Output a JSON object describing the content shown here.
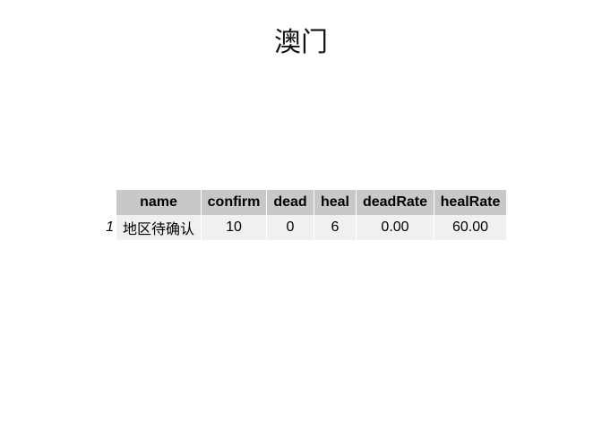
{
  "title": "澳门",
  "table": {
    "columns": [
      "",
      "name",
      "confirm",
      "dead",
      "heal",
      "deadRate",
      "healRate"
    ],
    "rows": [
      {
        "index": "1",
        "name": "地区待确认",
        "confirm": "10",
        "dead": "0",
        "heal": "6",
        "deadRate": "0.00",
        "healRate": "60.00"
      }
    ]
  },
  "colors": {
    "header_bg": "#c8c8c8",
    "cell_bg": "#f0f0f0"
  }
}
